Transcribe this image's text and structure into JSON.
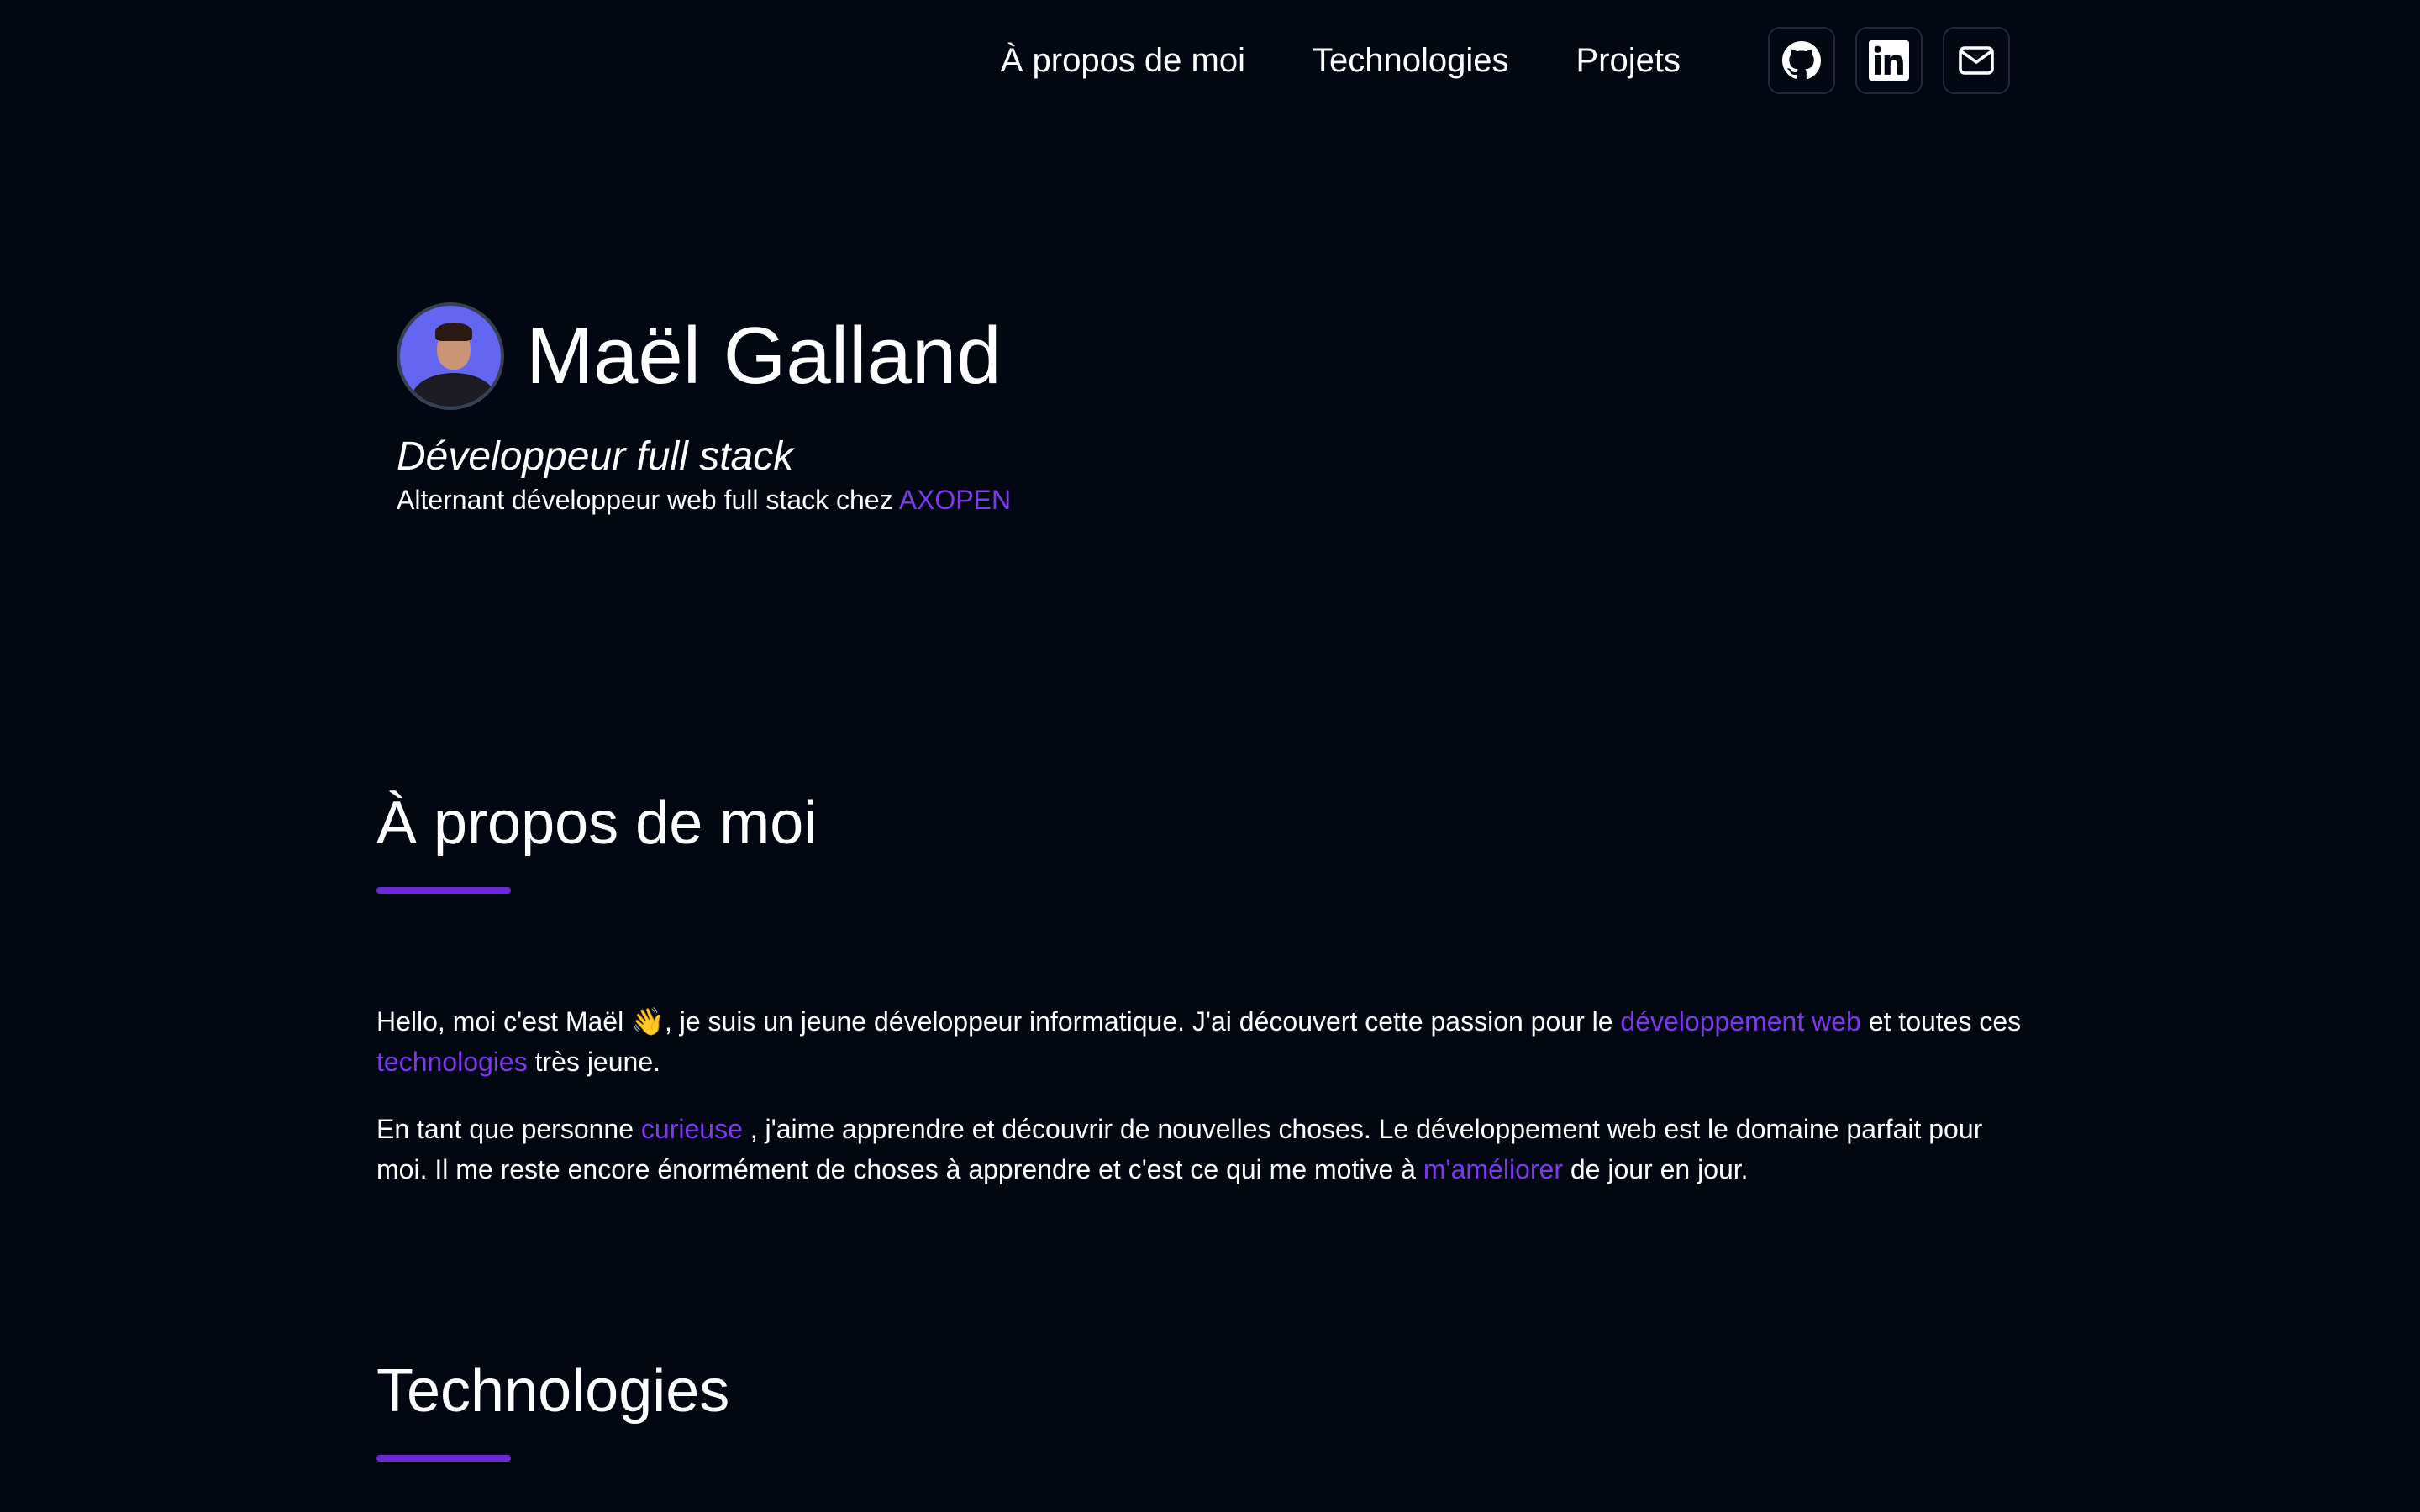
{
  "nav": {
    "links": [
      "À propos de moi",
      "Technologies",
      "Projets"
    ],
    "social": [
      "github-icon",
      "linkedin-icon",
      "mail-icon"
    ]
  },
  "hero": {
    "name": "Maël Galland",
    "role": "Développeur full stack",
    "subtitle_prefix": "Alternant développeur web full stack chez ",
    "company": "AXOPEN"
  },
  "about": {
    "title": "À propos de moi",
    "p1": {
      "t1": "Hello, moi c'est Maël 👋, je suis un jeune développeur informatique. J'ai découvert cette passion pour le ",
      "link1": "développement web",
      "t2": " et toutes ces ",
      "link2": "technologies",
      "t3": " très jeune."
    },
    "p2": {
      "t1": "En tant que personne ",
      "link1": "curieuse",
      "t2": " , j'aime apprendre et découvrir de nouvelles choses. Le développement web est le domaine parfait pour moi. Il me reste encore énormément de choses à apprendre et c'est ce qui me motive à ",
      "link2": "m'améliorer",
      "t3": " de jour en jour."
    }
  },
  "technologies": {
    "title": "Technologies"
  },
  "colors": {
    "background": "#030712",
    "accent": "#7c3aed",
    "bar": "#6d28d9",
    "text": "#ffffff"
  }
}
